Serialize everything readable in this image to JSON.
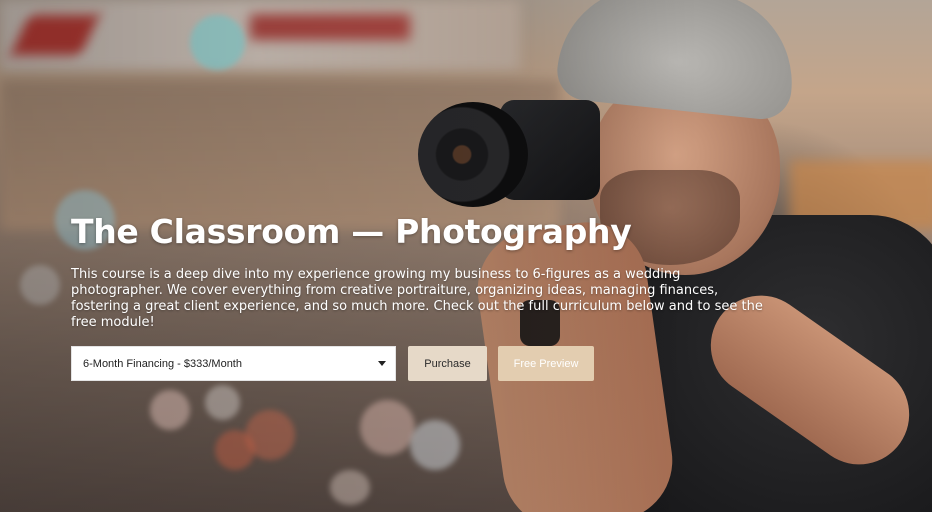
{
  "hero": {
    "title": "The Classroom — Photography",
    "description": "This course is a deep dive into my experience growing my business to 6-figures as a wedding photographer. We cover everything from creative portraiture, organizing ideas, managing finances, fostering a great client experience, and so much more. Check out the full curriculum below and to see the free module!"
  },
  "controls": {
    "plan_select": {
      "selected": "6-Month Financing - $333/Month"
    },
    "purchase_label": "Purchase",
    "preview_label": "Free Preview"
  },
  "colors": {
    "purchase_bg": "#e6d9c8",
    "preview_bg": "#e3cdb0",
    "title_text": "#ffffff"
  },
  "icons": {
    "select_caret": "chevron-down-icon"
  }
}
